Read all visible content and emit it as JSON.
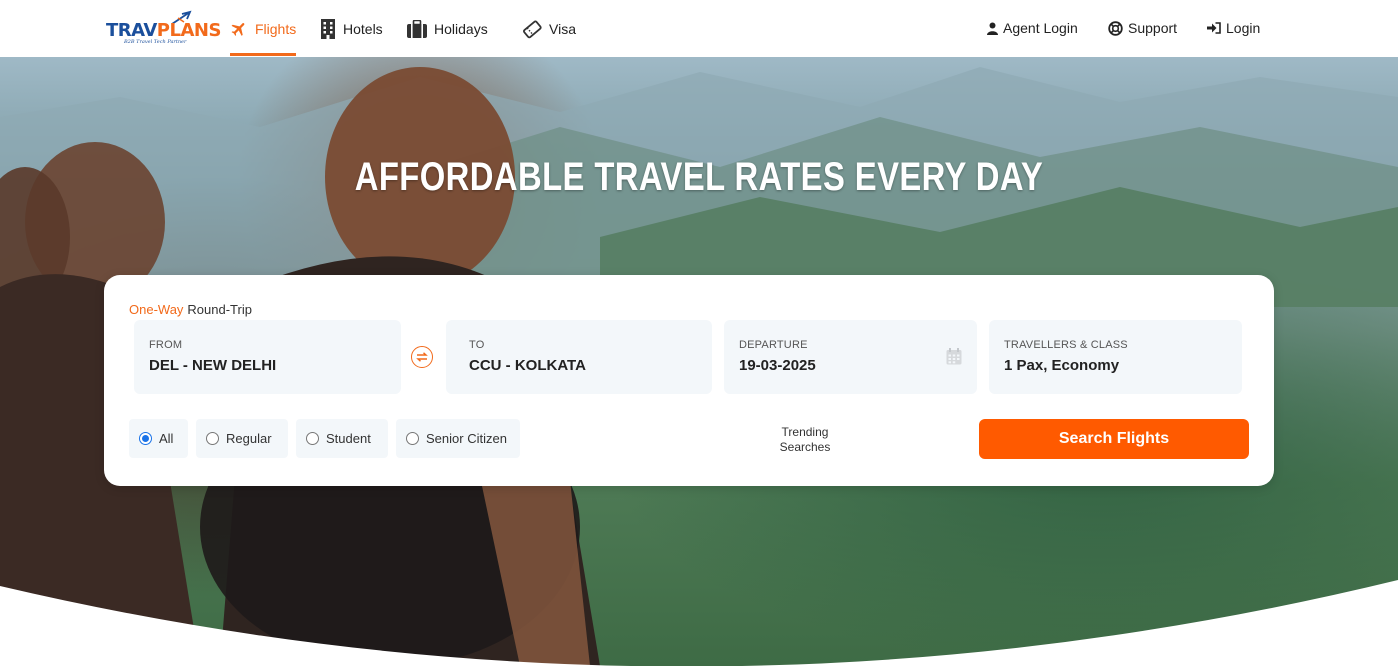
{
  "brand": {
    "logo_part1": "TRAV",
    "logo_part2": "PLANS",
    "tagline": "B2B Travel Tech Partner"
  },
  "nav": {
    "flights": "Flights",
    "hotels": "Hotels",
    "holidays": "Holidays",
    "visa": "Visa"
  },
  "header_links": {
    "agent_login": "Agent Login",
    "support": "Support",
    "login": "Login"
  },
  "hero": {
    "title": "AFFORDABLE TRAVEL RATES EVERY DAY"
  },
  "search": {
    "trip_types": [
      "One-Way",
      "Round-Trip"
    ],
    "from_label": "FROM",
    "from_value": "DEL - NEW DELHI",
    "to_label": "TO",
    "to_value": "CCU - KOLKATA",
    "departure_label": "DEPARTURE",
    "departure_value": "19-03-2025",
    "travellers_label": "TRAVELLERS & CLASS",
    "travellers_value": "1 Pax, Economy",
    "fare_types": [
      "All",
      "Regular",
      "Student",
      "Senior Citizen"
    ],
    "selected_fare": "All",
    "trending_line1": "Trending",
    "trending_line2": "Searches",
    "button": "Search Flights"
  },
  "colors": {
    "accent": "#f26a1b",
    "button": "#ff5a00",
    "brand_blue": "#1b4f9c",
    "field_bg": "#f3f7fa"
  },
  "icons": [
    "plane-icon",
    "hotel-building-icon",
    "suitcase-icon",
    "visa-ticket-icon",
    "user-icon",
    "lifebuoy-icon",
    "login-arrow-icon",
    "swap-icon",
    "calendar-icon"
  ]
}
